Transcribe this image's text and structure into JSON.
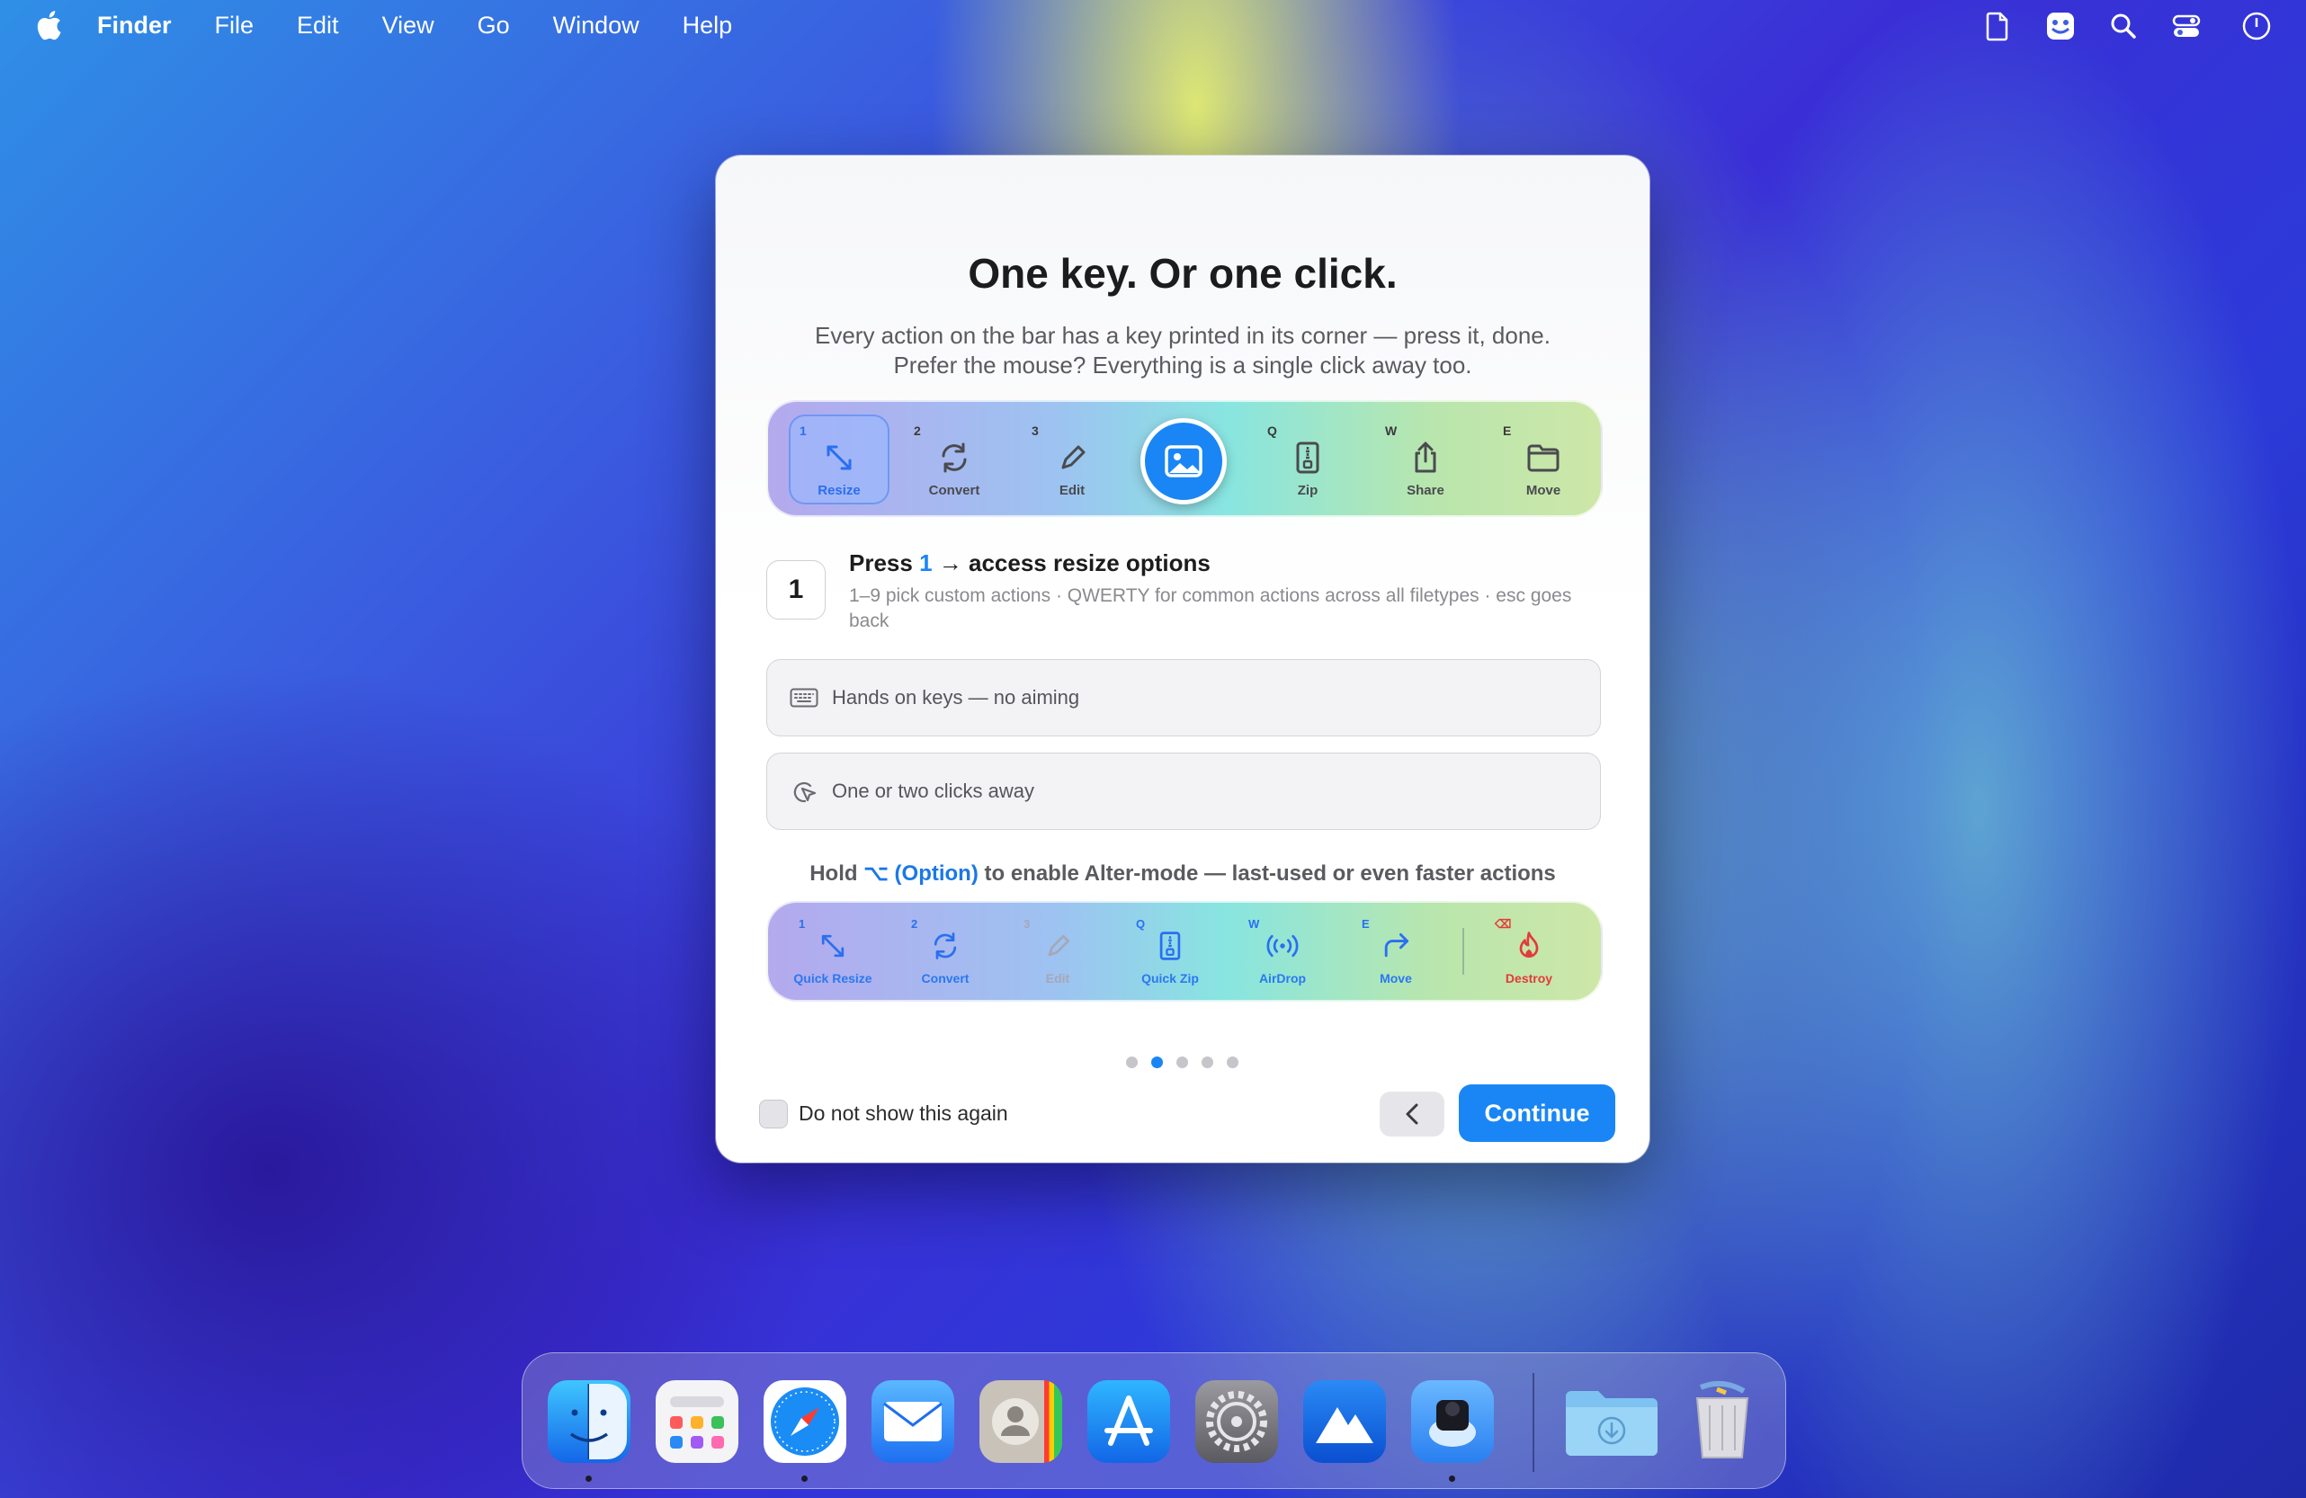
{
  "menubar": {
    "app": "Finder",
    "items": [
      "File",
      "Edit",
      "View",
      "Go",
      "Window",
      "Help"
    ]
  },
  "dialog": {
    "title": "One key. Or one click.",
    "subtitle_line1": "Every action on the bar has a key printed in its corner — press it, done.",
    "subtitle_line2": "Prefer the mouse? Everything is a single click away too.",
    "actions": [
      {
        "key": "1",
        "label": "Resize",
        "icon": "resize-icon",
        "selected": true
      },
      {
        "key": "2",
        "label": "Convert",
        "icon": "convert-icon"
      },
      {
        "key": "3",
        "label": "Edit",
        "icon": "pencil-icon"
      },
      {
        "key": "Q",
        "label": "Zip",
        "icon": "zip-icon"
      },
      {
        "key": "W",
        "label": "Share",
        "icon": "share-icon"
      },
      {
        "key": "E",
        "label": "Move",
        "icon": "folder-icon"
      }
    ],
    "step": {
      "number": "1",
      "title_prefix": "Press",
      "title_key": "1",
      "title_suffix": "→ access resize options",
      "desc": "1–9 pick custom actions · QWERTY for common actions across all filetypes · esc goes back"
    },
    "option_keys": "Hands on keys — no aiming",
    "option_clicks": "One or two clicks away",
    "hold": {
      "prefix": "Hold",
      "key": "⌥ (Option)",
      "suffix": "to enable Alter-mode — last-used or even faster actions"
    },
    "alter_actions": [
      {
        "key": "1",
        "label": "Quick Resize",
        "icon": "resize-icon"
      },
      {
        "key": "2",
        "label": "Convert",
        "icon": "convert-icon"
      },
      {
        "key": "3",
        "label": "Edit",
        "icon": "pencil-icon",
        "dim": true
      },
      {
        "key": "Q",
        "label": "Quick Zip",
        "icon": "zip-icon"
      },
      {
        "key": "W",
        "label": "AirDrop",
        "icon": "airdrop-icon"
      },
      {
        "key": "E",
        "label": "Move",
        "icon": "redirect-arrow-icon"
      },
      {
        "key": "⌫",
        "label": "Destroy",
        "icon": "flame-icon",
        "red": true
      }
    ],
    "pagination": {
      "current": 2,
      "total": 5
    },
    "dont_show": "Do not show this again",
    "continue": "Continue"
  },
  "colors": {
    "accent": "#1a86f5",
    "danger": "#e23b3b"
  },
  "dock": {
    "apps": [
      "Finder",
      "Launchpad",
      "Safari",
      "Mail",
      "Contacts",
      "App Store",
      "System Settings",
      "Mountain App",
      "Capture App",
      "Downloads",
      "Trash"
    ],
    "running": [
      "Finder",
      "Safari",
      "Capture App"
    ]
  }
}
